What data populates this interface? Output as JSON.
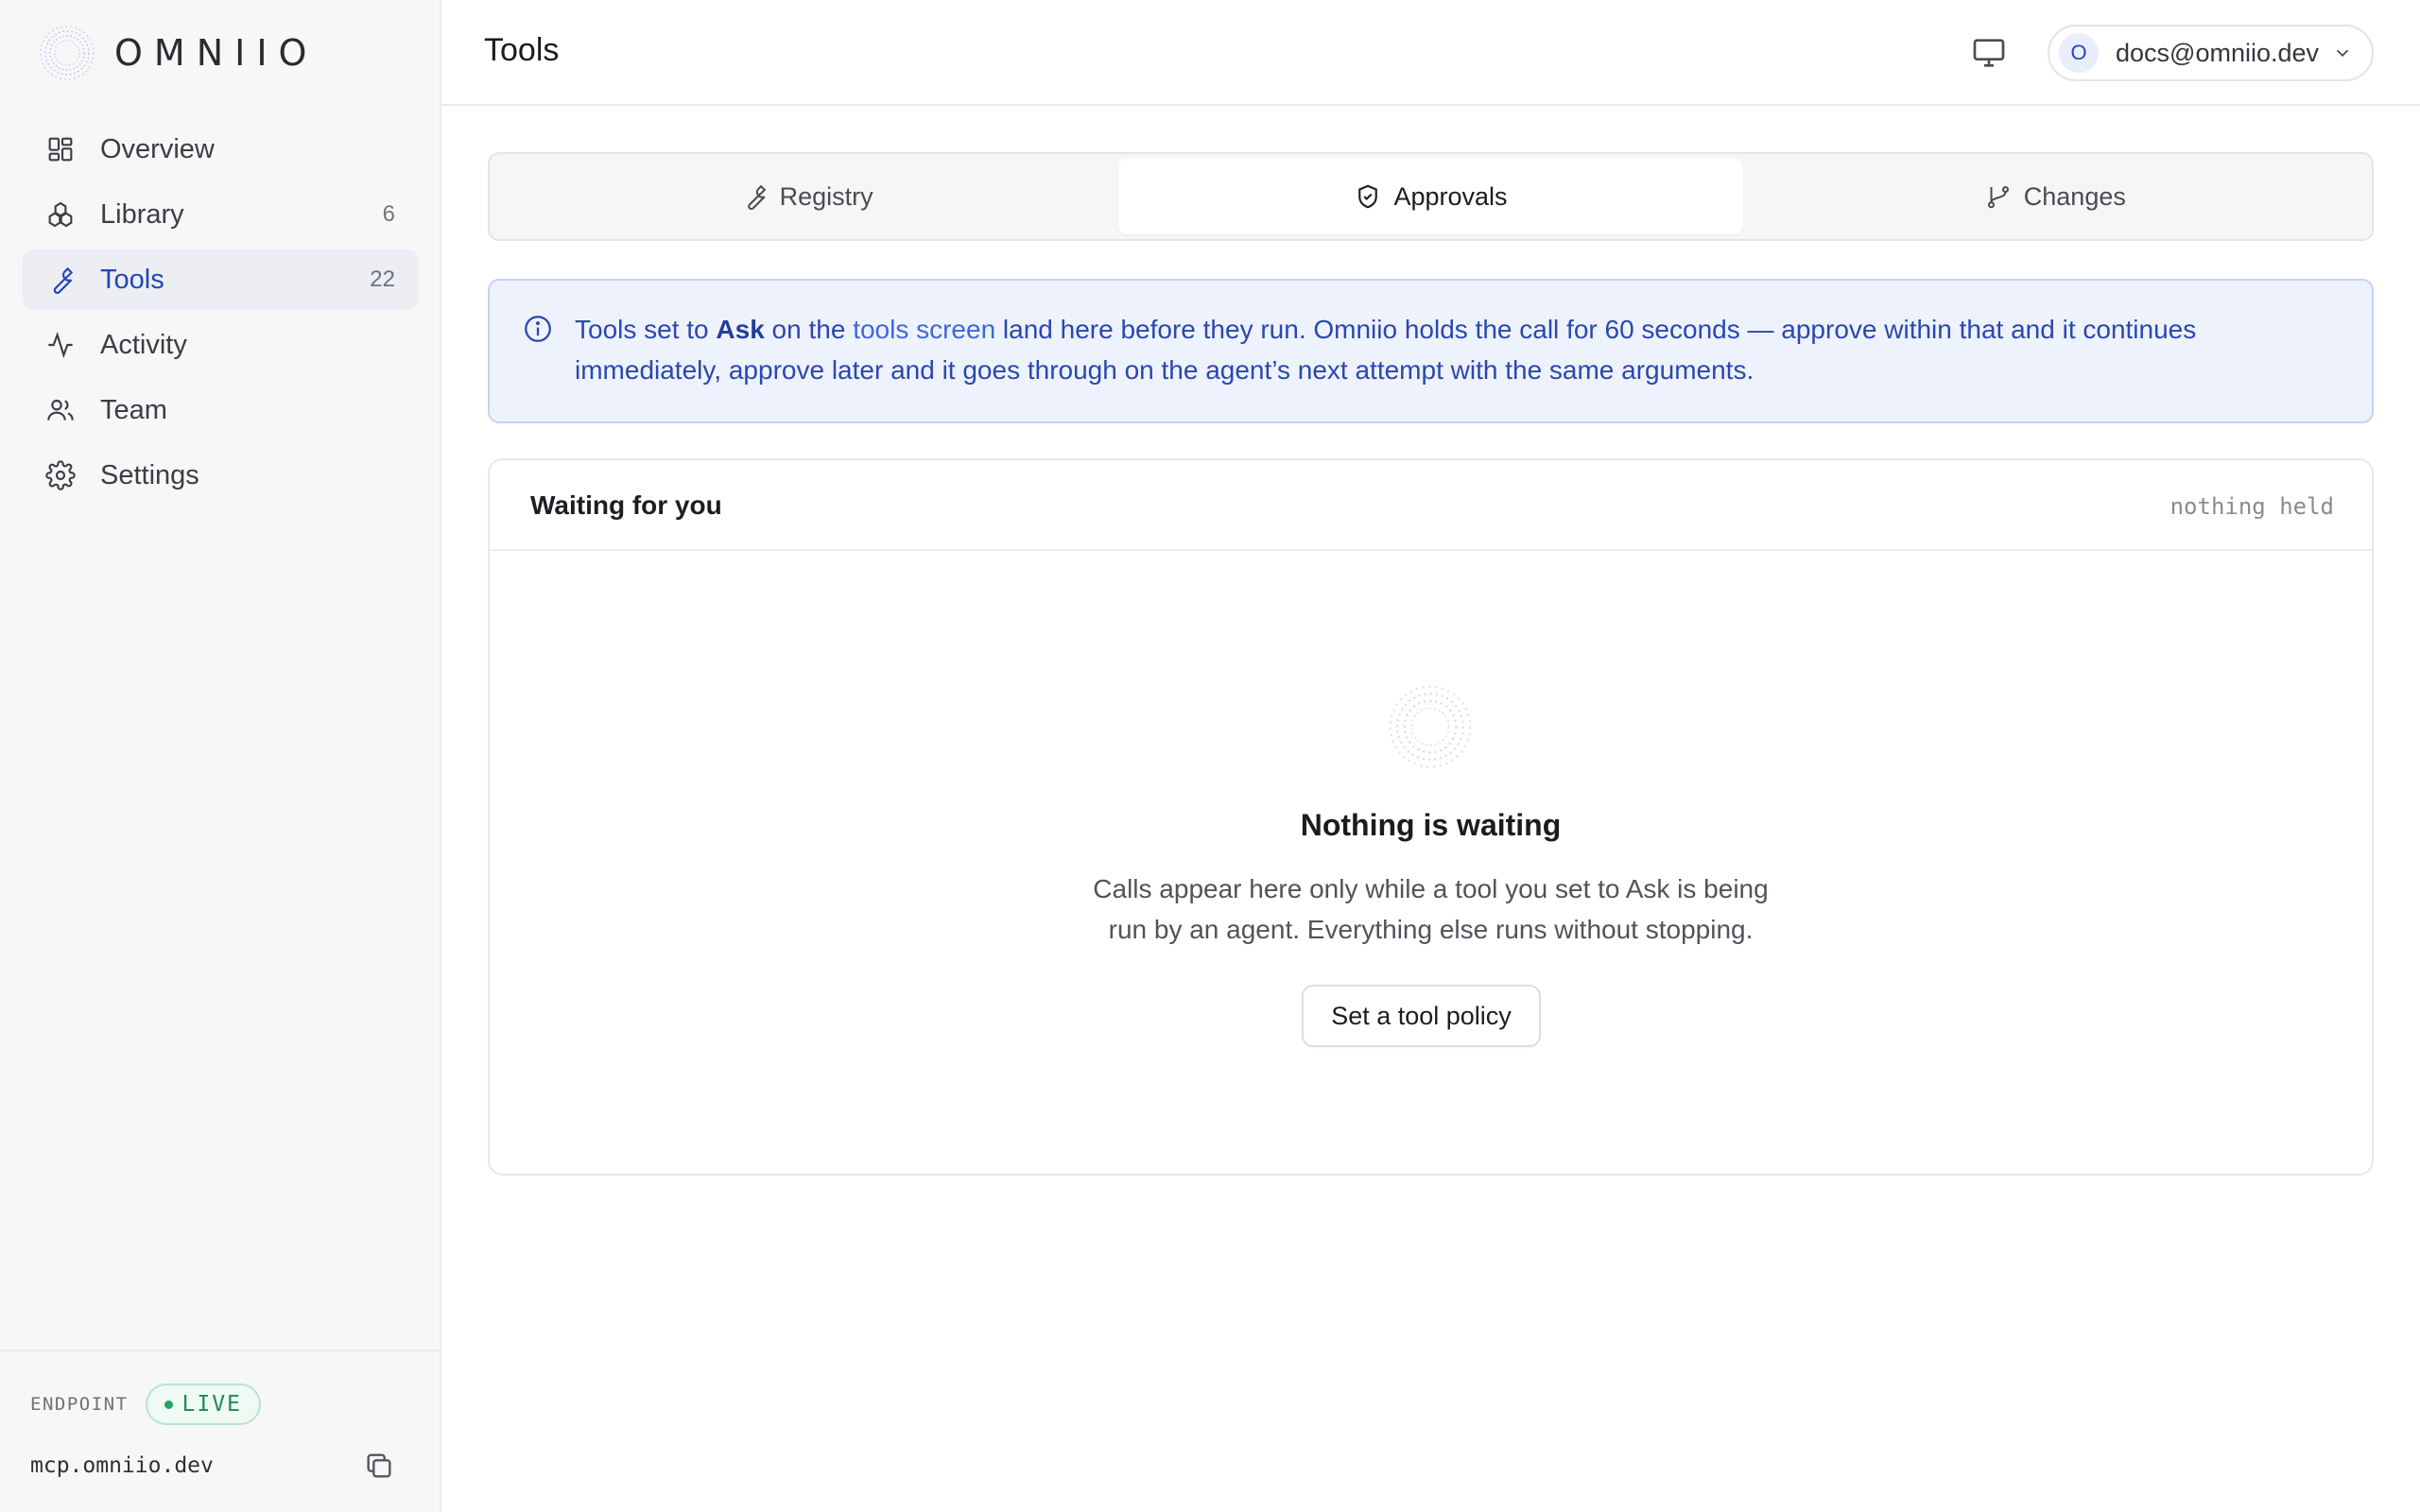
{
  "brand": {
    "name": "OMNIIO"
  },
  "sidebar": {
    "items": [
      {
        "label": "Overview",
        "count": "",
        "icon": "grid-icon"
      },
      {
        "label": "Library",
        "count": "6",
        "icon": "library-icon"
      },
      {
        "label": "Tools",
        "count": "22",
        "icon": "wrench-icon"
      },
      {
        "label": "Activity",
        "count": "",
        "icon": "activity-icon"
      },
      {
        "label": "Team",
        "count": "",
        "icon": "team-icon"
      },
      {
        "label": "Settings",
        "count": "",
        "icon": "gear-icon"
      }
    ],
    "active_item": "Tools",
    "footer": {
      "endpoint_label": "ENDPOINT",
      "status": "LIVE",
      "url": "mcp.omniio.dev"
    }
  },
  "header": {
    "title": "Tools",
    "account": {
      "initial": "O",
      "email": "docs@omniio.dev"
    }
  },
  "tabs": [
    {
      "label": "Registry",
      "icon": "wrench-icon"
    },
    {
      "label": "Approvals",
      "icon": "shield-check-icon"
    },
    {
      "label": "Changes",
      "icon": "git-branch-icon"
    }
  ],
  "active_tab": "Approvals",
  "info": {
    "part1": "Tools set to ",
    "bold": "Ask",
    "part2": " on the ",
    "link": "tools screen",
    "part3": " land here before they run. Omniio holds the call for 60 seconds — approve within that and it continues immediately, approve later and it goes through on the agent’s next attempt with the same arguments."
  },
  "waiting": {
    "title": "Waiting for you",
    "status": "nothing held",
    "empty_title": "Nothing is waiting",
    "empty_desc_line1": "Calls appear here only while a tool you set to Ask is being",
    "empty_desc_line2": "run by an agent. Everything else runs without stopping.",
    "button": "Set a tool policy"
  },
  "colors": {
    "accent": "#2246b8",
    "live_green": "#1d8a55",
    "info_bg": "#eef2fd"
  }
}
